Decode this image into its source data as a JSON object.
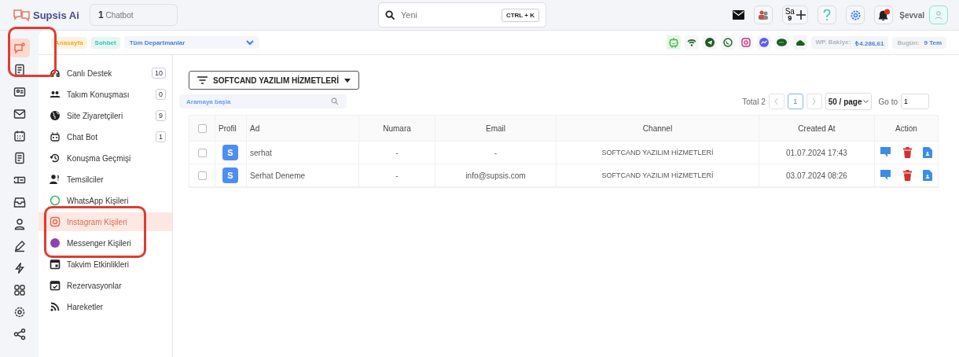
{
  "header": {
    "brand": "Supsis Ai",
    "chatbot_count": "1",
    "chatbot_label": "Chatbot",
    "search": {
      "placeholder": "Yeni",
      "shortcut": "CTRL + K"
    },
    "sa_label": "Sa",
    "sa_count": "9",
    "user": "Şevval"
  },
  "toolbar": {
    "tabs": [
      {
        "label": "Anasayfa",
        "selected": false,
        "color": "#f5a623"
      },
      {
        "label": "Sohbet",
        "selected": false,
        "color": "#3bbfa8"
      }
    ],
    "department": "Tüm Departmanlar",
    "balance_label": "WP. Bakiye:",
    "balance": "₺4.286,61",
    "today_label": "Bugün:",
    "today": "9 Tem"
  },
  "rail": [
    {
      "selected": true
    },
    {
      "selected": false
    },
    {
      "selected": false
    },
    {
      "selected": false
    },
    {
      "selected": false
    },
    {
      "selected": false
    },
    {
      "selected": false
    },
    {
      "selected": false
    },
    {
      "selected": false
    },
    {
      "selected": false
    },
    {
      "selected": false
    },
    {
      "selected": false
    },
    {
      "selected": false
    },
    {
      "selected": false
    }
  ],
  "sidebar": {
    "items": [
      {
        "label": "Canlı Destek",
        "count": "10",
        "selected": false
      },
      {
        "label": "Takım Konuşması",
        "count": "0",
        "selected": false
      },
      {
        "label": "Site Ziyaretçileri",
        "count": "9",
        "selected": false
      },
      {
        "label": "Chat Bot",
        "count": "1",
        "selected": false
      },
      {
        "label": "Konuşma Geçmişi",
        "selected": false
      },
      {
        "label": "Temsilciler",
        "selected": false
      },
      {
        "label": "WhatsApp Kişileri",
        "selected": false
      },
      {
        "label": "Instagram Kişileri",
        "selected": true
      },
      {
        "label": "Messenger Kişileri",
        "selected": false
      },
      {
        "label": "Takvim Etkinlikleri",
        "selected": false
      },
      {
        "label": "Rezervasyonlar",
        "selected": false
      },
      {
        "label": "Hareketler",
        "selected": false
      }
    ]
  },
  "filter": "SOFTCAND YAZILIM HİZMETLERİ",
  "search": {
    "placeholder": "Aramaya başla"
  },
  "pagination": {
    "total": "Total 2",
    "page": "1",
    "page_size": "50 / page",
    "goto_label": "Go to",
    "goto_value": "1"
  },
  "table": {
    "select_all_checked": false,
    "columns": [
      "Profil",
      "Ad",
      "Numara",
      "Email",
      "Channel",
      "Created At",
      "Action"
    ],
    "rows": [
      {
        "checked": false,
        "avatar": "S",
        "name": "serhat",
        "number": "-",
        "email": "-",
        "channel": "SOFTCAND YAZILIM HİZMETLERİ",
        "created_at": "01.07.2024 17:43"
      },
      {
        "checked": false,
        "avatar": "S",
        "name": "Serhat Deneme",
        "number": "-",
        "email": "info@supsis.com",
        "channel": "SOFTCAND YAZILIM HİZMETLERİ",
        "created_at": "03.07.2024 08:26"
      }
    ]
  }
}
